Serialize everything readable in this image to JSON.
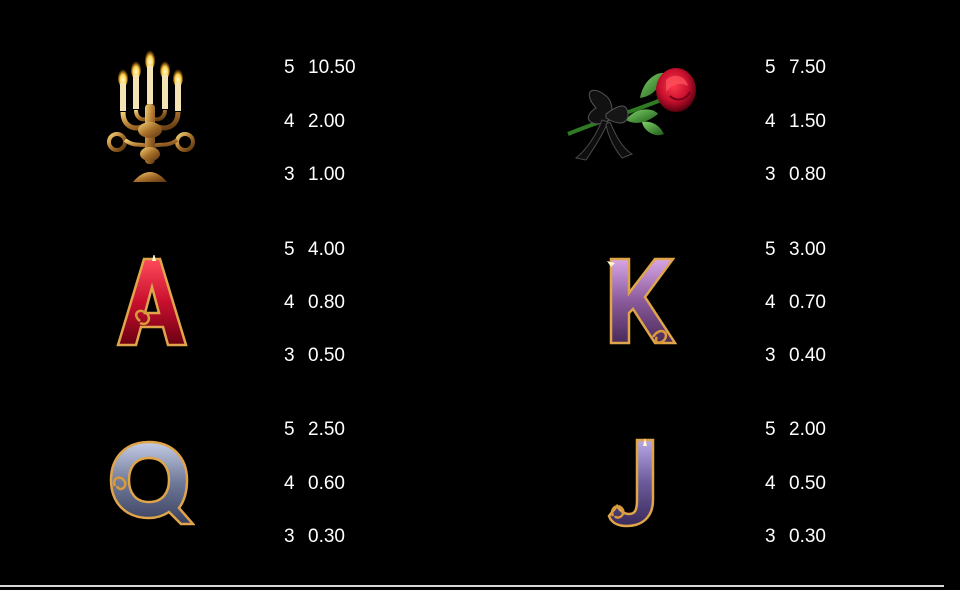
{
  "paytable": [
    {
      "symbol": "candelabra-icon",
      "pays": [
        {
          "count": "5",
          "value": "10.50"
        },
        {
          "count": "4",
          "value": "2.00"
        },
        {
          "count": "3",
          "value": "1.00"
        }
      ]
    },
    {
      "symbol": "rose-icon",
      "pays": [
        {
          "count": "5",
          "value": "7.50"
        },
        {
          "count": "4",
          "value": "1.50"
        },
        {
          "count": "3",
          "value": "0.80"
        }
      ]
    },
    {
      "symbol": "letter-a-icon",
      "pays": [
        {
          "count": "5",
          "value": "4.00"
        },
        {
          "count": "4",
          "value": "0.80"
        },
        {
          "count": "3",
          "value": "0.50"
        }
      ]
    },
    {
      "symbol": "letter-k-icon",
      "pays": [
        {
          "count": "5",
          "value": "3.00"
        },
        {
          "count": "4",
          "value": "0.70"
        },
        {
          "count": "3",
          "value": "0.40"
        }
      ]
    },
    {
      "symbol": "letter-q-icon",
      "pays": [
        {
          "count": "5",
          "value": "2.50"
        },
        {
          "count": "4",
          "value": "0.60"
        },
        {
          "count": "3",
          "value": "0.30"
        }
      ]
    },
    {
      "symbol": "letter-j-icon",
      "pays": [
        {
          "count": "5",
          "value": "2.00"
        },
        {
          "count": "4",
          "value": "0.50"
        },
        {
          "count": "3",
          "value": "0.30"
        }
      ]
    }
  ],
  "colors": {
    "background": "#000000",
    "text": "#ffffff",
    "gold": "#c9953f",
    "red": "#c8102e",
    "purple": "#8a5a9a",
    "steel": "#6e7897",
    "violet": "#6a5a9a"
  }
}
